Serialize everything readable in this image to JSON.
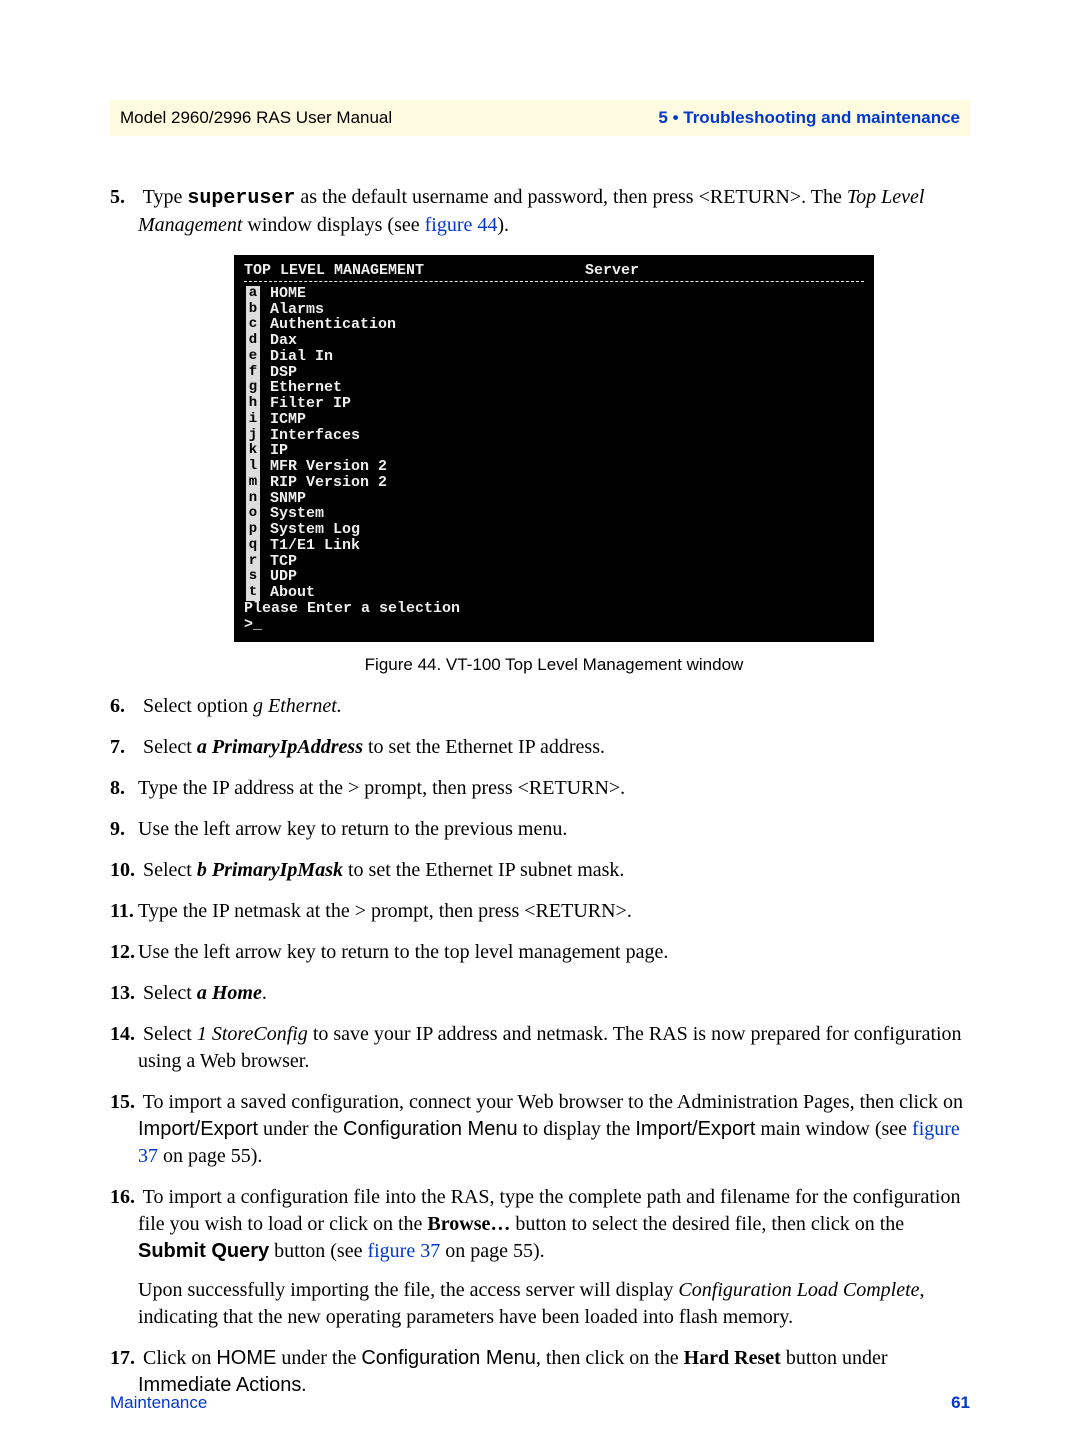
{
  "header": {
    "manual": "Model 2960/2996 RAS User Manual",
    "section": "5 • Troubleshooting and maintenance"
  },
  "terminal": {
    "title_left": "TOP LEVEL MANAGEMENT",
    "title_right": "Server",
    "items": [
      {
        "k": "a",
        "l": "HOME"
      },
      {
        "k": "b",
        "l": "Alarms"
      },
      {
        "k": "c",
        "l": "Authentication"
      },
      {
        "k": "d",
        "l": "Dax"
      },
      {
        "k": "e",
        "l": "Dial In"
      },
      {
        "k": "f",
        "l": "DSP"
      },
      {
        "k": "g",
        "l": "Ethernet"
      },
      {
        "k": "h",
        "l": "Filter IP"
      },
      {
        "k": "i",
        "l": "ICMP"
      },
      {
        "k": "j",
        "l": "Interfaces"
      },
      {
        "k": "k",
        "l": "IP"
      },
      {
        "k": "l",
        "l": "MFR Version 2"
      },
      {
        "k": "m",
        "l": "RIP Version 2"
      },
      {
        "k": "n",
        "l": "SNMP"
      },
      {
        "k": "o",
        "l": "System"
      },
      {
        "k": "p",
        "l": "System Log"
      },
      {
        "k": "q",
        "l": "T1/E1 Link"
      },
      {
        "k": "r",
        "l": "TCP"
      },
      {
        "k": "s",
        "l": "UDP"
      },
      {
        "k": "t",
        "l": "About"
      }
    ],
    "prompt1": "Please Enter a selection",
    "prompt2": ">_"
  },
  "fig_caption": "Figure 44. VT-100 Top Level Management window",
  "steps": {
    "s5a": "Type ",
    "s5_su": "superuser",
    "s5b": " as the default username and password, then press <RETURN>. The ",
    "s5c": "Top Level Management",
    "s5d": " window displays (see ",
    "s5e": "figure 44",
    "s5f": ").",
    "s6a": "Select option ",
    "s6b": "g Ethernet.",
    "s7a": "Select ",
    "s7b": "a PrimaryIpAddress",
    "s7c": " to set the Ethernet IP address.",
    "s8": "Type the IP address at the > prompt, then press <RETURN>.",
    "s9": "Use the left arrow key to return to the previous menu.",
    "s10a": "Select ",
    "s10b": "b PrimaryIpMask",
    "s10c": " to set the Ethernet IP subnet mask.",
    "s11": "Type the IP netmask at the > prompt, then press <RETURN>.",
    "s12": "Use the left arrow key to return to the top level management page.",
    "s13a": "Select ",
    "s13b": "a Home",
    "s13c": ".",
    "s14a": "Select ",
    "s14b": "1 StoreConfig",
    "s14c": " to save your IP address and netmask. The RAS is now prepared for configuration using a Web browser.",
    "s15a": "To import a saved configuration, connect your Web browser to the Administration Pages, then click on ",
    "s15b": "Import/Export",
    "s15c": " under the ",
    "s15d": "Configuration Menu",
    "s15e": " to display the ",
    "s15f": "Import/Export",
    "s15g": " main window (see ",
    "s15h": "figure 37",
    "s15i": " on page 55).",
    "s16a": "To import a configuration file into the RAS, type the complete path and filename for the configuration file you wish to load or click on the ",
    "s16b": "Browse…",
    "s16c": " button to select the desired file, then click on the ",
    "s16d": "Submit Query",
    "s16e": " button (see ",
    "s16f": "figure 37",
    "s16g": " on page 55).",
    "s16p2a": "Upon successfully importing the file, the access server will display ",
    "s16p2b": "Configuration Load Complete",
    "s16p2c": ", indicating that the new operating parameters have been loaded into flash memory.",
    "s17a": "Click on ",
    "s17b": "HOME",
    "s17c": " under the ",
    "s17d": "Configuration Menu",
    "s17e": ", then click on the ",
    "s17f": "Hard Reset",
    "s17g": " button under ",
    "s17h": "Immediate Actions",
    "s17i": "."
  },
  "footer": {
    "section": "Maintenance",
    "page": "61"
  }
}
